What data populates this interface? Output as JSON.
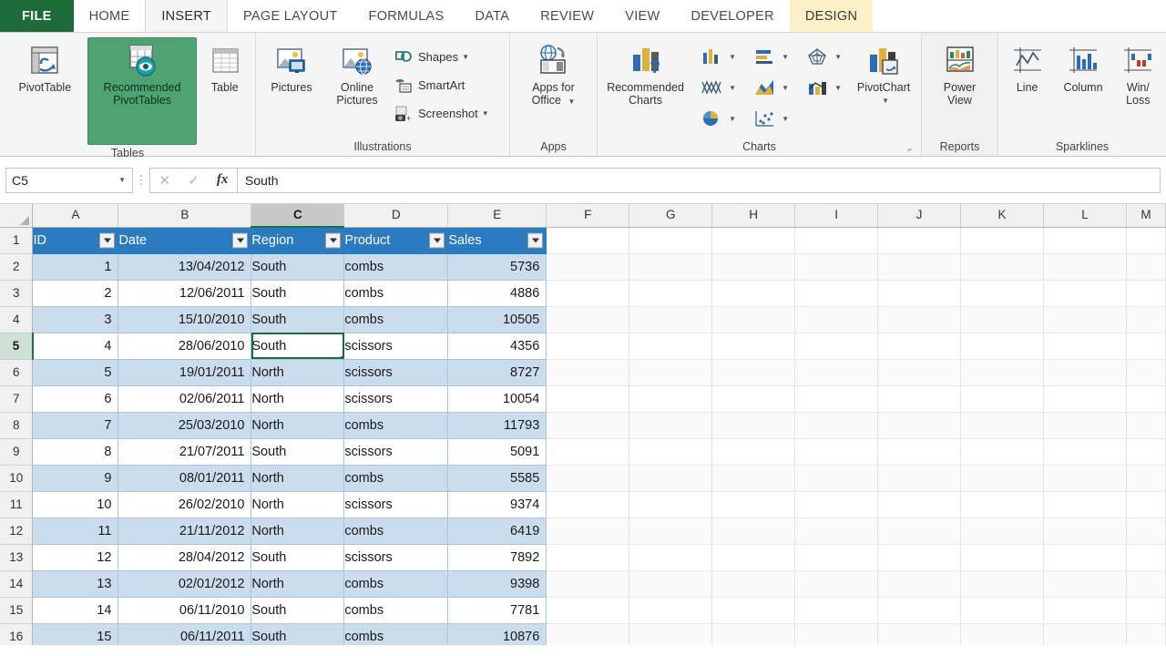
{
  "ribbon": {
    "tabs": [
      {
        "label": "FILE",
        "state": "file"
      },
      {
        "label": "HOME",
        "state": "normal"
      },
      {
        "label": "INSERT",
        "state": "active"
      },
      {
        "label": "PAGE LAYOUT",
        "state": "normal"
      },
      {
        "label": "FORMULAS",
        "state": "normal"
      },
      {
        "label": "DATA",
        "state": "normal"
      },
      {
        "label": "REVIEW",
        "state": "normal"
      },
      {
        "label": "VIEW",
        "state": "normal"
      },
      {
        "label": "DEVELOPER",
        "state": "normal"
      },
      {
        "label": "DESIGN",
        "state": "contextual"
      }
    ],
    "groups": {
      "tables": {
        "label": "Tables",
        "pivot_table": "PivotTable",
        "recommended_pivot_tables_l1": "Recommended",
        "recommended_pivot_tables_l2": "PivotTables",
        "table": "Table"
      },
      "illustrations": {
        "label": "Illustrations",
        "pictures": "Pictures",
        "online_pictures_l1": "Online",
        "online_pictures_l2": "Pictures",
        "shapes": "Shapes",
        "smartart": "SmartArt",
        "screenshot": "Screenshot"
      },
      "apps": {
        "label": "Apps",
        "apps_for_office_l1": "Apps for",
        "apps_for_office_l2": "Office"
      },
      "charts": {
        "label": "Charts",
        "recommended_charts_l1": "Recommended",
        "recommended_charts_l2": "Charts",
        "pivot_chart": "PivotChart",
        "icons": [
          "column-chart-icon",
          "bar-chart-icon",
          "radar-chart-icon",
          "line-chart-icon",
          "area-chart-icon",
          "combo-chart-icon",
          "pie-chart-icon",
          "scatter-chart-icon"
        ]
      },
      "reports": {
        "label": "Reports",
        "power_view_l1": "Power",
        "power_view_l2": "View"
      },
      "sparklines": {
        "label": "Sparklines",
        "line": "Line",
        "column": "Column",
        "winloss_l1": "Win/",
        "winloss_l2": "Loss"
      }
    }
  },
  "formula_bar": {
    "name_box_value": "C5",
    "cancel_icon": "close-icon",
    "confirm_icon": "check-icon",
    "function_icon": "fx-icon",
    "formula_value": "South"
  },
  "grid": {
    "column_headers": [
      "A",
      "B",
      "C",
      "D",
      "E",
      "F",
      "G",
      "H",
      "I",
      "J",
      "K",
      "L",
      "M"
    ],
    "selected_column": "C",
    "selected_row": 5,
    "selected_cell": "C5",
    "row_numbers": [
      1,
      2,
      3,
      4,
      5,
      6,
      7,
      8,
      9,
      10,
      11,
      12,
      13,
      14,
      15,
      16
    ],
    "table_headers": [
      "ID",
      "Date",
      "Region",
      "Product",
      "Sales"
    ],
    "rows": [
      {
        "id": "1",
        "date": "13/04/2012",
        "region": "South",
        "product": "combs",
        "sales": "5736"
      },
      {
        "id": "2",
        "date": "12/06/2011",
        "region": "South",
        "product": "combs",
        "sales": "4886"
      },
      {
        "id": "3",
        "date": "15/10/2010",
        "region": "South",
        "product": "combs",
        "sales": "10505"
      },
      {
        "id": "4",
        "date": "28/06/2010",
        "region": "South",
        "product": "scissors",
        "sales": "4356"
      },
      {
        "id": "5",
        "date": "19/01/2011",
        "region": "North",
        "product": "scissors",
        "sales": "8727"
      },
      {
        "id": "6",
        "date": "02/06/2011",
        "region": "North",
        "product": "scissors",
        "sales": "10054"
      },
      {
        "id": "7",
        "date": "25/03/2010",
        "region": "North",
        "product": "combs",
        "sales": "11793"
      },
      {
        "id": "8",
        "date": "21/07/2011",
        "region": "South",
        "product": "scissors",
        "sales": "5091"
      },
      {
        "id": "9",
        "date": "08/01/2011",
        "region": "North",
        "product": "combs",
        "sales": "5585"
      },
      {
        "id": "10",
        "date": "26/02/2010",
        "region": "North",
        "product": "scissors",
        "sales": "9374"
      },
      {
        "id": "11",
        "date": "21/11/2012",
        "region": "North",
        "product": "combs",
        "sales": "6419"
      },
      {
        "id": "12",
        "date": "28/04/2012",
        "region": "South",
        "product": "scissors",
        "sales": "7892"
      },
      {
        "id": "13",
        "date": "02/01/2012",
        "region": "North",
        "product": "combs",
        "sales": "9398"
      },
      {
        "id": "14",
        "date": "06/11/2010",
        "region": "South",
        "product": "combs",
        "sales": "7781"
      },
      {
        "id": "15",
        "date": "06/11/2011",
        "region": "South",
        "product": "combs",
        "sales": "10876"
      }
    ]
  },
  "colors": {
    "file_tab_green": "#1e6b3a",
    "contextual_tab": "#fbf0c8",
    "table_header_blue": "#2b7bc0",
    "table_band_blue": "#cbdcec",
    "selection_green": "#1b6b3f",
    "hover_green": "#4fa372"
  }
}
